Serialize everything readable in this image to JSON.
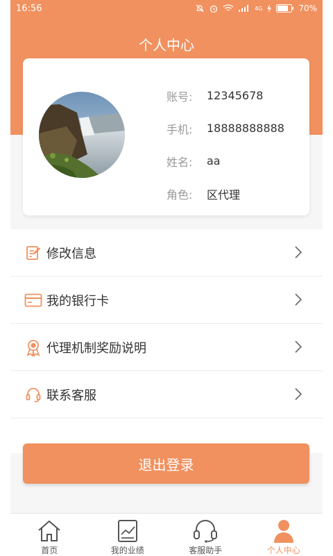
{
  "status_bar": {
    "time": "16:56",
    "battery_text": "70%",
    "network_text": "4G"
  },
  "header": {
    "title": "个人中心"
  },
  "profile": {
    "rows": [
      {
        "label": "账号:",
        "value": "12345678"
      },
      {
        "label": "手机:",
        "value": "18888888888"
      },
      {
        "label": "姓名:",
        "value": "aa"
      },
      {
        "label": "角色:",
        "value": "区代理"
      }
    ]
  },
  "menu": {
    "items": [
      {
        "label": "修改信息",
        "icon": "edit-document-icon"
      },
      {
        "label": "我的银行卡",
        "icon": "bank-card-icon"
      },
      {
        "label": "代理机制奖励说明",
        "icon": "award-ribbon-icon"
      },
      {
        "label": "联系客服",
        "icon": "headset-icon"
      }
    ]
  },
  "logout": {
    "label": "退出登录"
  },
  "tabbar": {
    "tabs": [
      {
        "label": "首页",
        "icon": "home-icon"
      },
      {
        "label": "我的业绩",
        "icon": "performance-chart-icon"
      },
      {
        "label": "客服助手",
        "icon": "headphones-icon"
      },
      {
        "label": "个人中心",
        "icon": "person-icon",
        "active": true
      }
    ]
  },
  "colors": {
    "accent": "#f1915f",
    "background": "#f6f6f6",
    "text": "#333333",
    "label": "#9a9a9a"
  }
}
